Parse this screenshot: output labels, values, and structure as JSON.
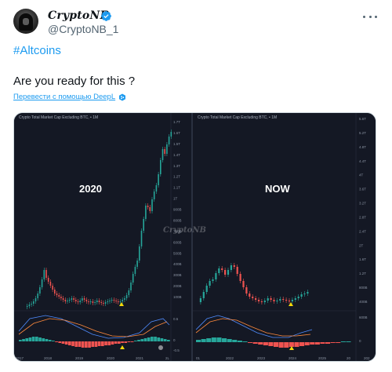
{
  "tweet": {
    "display_name": "CryptoNB",
    "handle": "@CryptoNB_1",
    "hashtag": "#Altcoins",
    "text": "Are you ready for this ?",
    "translate_link": "Перевести с помощью DeepL"
  },
  "icons": {
    "avatar": "avatar-image",
    "verified": "verified-badge-icon",
    "more": "more-options-icon",
    "translate": "deepl-logo-icon"
  },
  "colors": {
    "link": "#1d9bf0",
    "up": "#26a69a",
    "down": "#ef5350",
    "marker": "#f5d90a"
  },
  "image": {
    "left": {
      "title": "Crypto Total Market Cap Excluding BTC, • 1M",
      "label": "2020",
      "x_ticks": [
        "2017",
        "2018",
        "2019",
        "2020",
        "2021",
        "2L"
      ],
      "y_ticks": [
        "1.7T",
        "1.6T",
        "1.5T",
        "1.4T",
        "1.3T",
        "1.2T",
        "1.1T",
        "1T",
        "900B",
        "800B",
        "700B",
        "600B",
        "500B",
        "400B",
        "300B",
        "200B",
        "100B"
      ],
      "osc_ticks": [
        "0.5",
        "0",
        "-0.5"
      ]
    },
    "right": {
      "title": "Crypto Total Market Cap Excluding BTC, • 1M",
      "label": "NOW",
      "x_ticks": [
        "01",
        "2022",
        "2023",
        "2024",
        "2025",
        "20",
        "202"
      ],
      "y_ticks": [
        "5.6T",
        "5.2T",
        "4.8T",
        "4.4T",
        "4T",
        "3.6T",
        "3.2T",
        "2.8T",
        "2.4T",
        "2T",
        "1.6T",
        "1.2T",
        "800B",
        "400B"
      ],
      "osc_ticks": [
        "600B",
        "0"
      ]
    },
    "watermark": "CryptoNB"
  }
}
